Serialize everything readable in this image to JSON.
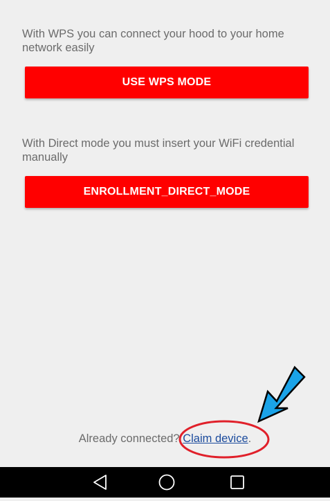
{
  "enrollment": {
    "wps_description": "With WPS you can connect your hood to your home network easily",
    "wps_button_label": "USE WPS MODE",
    "direct_description": "With Direct mode you must insert your WiFi credential manually",
    "direct_button_label": "ENROLLMENT_DIRECT_MODE"
  },
  "footer": {
    "already_connected_text": "Already connected?",
    "claim_link_label": "Claim device",
    "period": "."
  },
  "annotation": {
    "arrow_color": "#1aa3e8",
    "circle_color": "#e0202a"
  },
  "navigation_bar": {
    "items": [
      "back-icon",
      "home-icon",
      "recents-icon"
    ]
  },
  "colors": {
    "button_red": "#ff0000",
    "background": "#efefef",
    "link_blue": "#1a4a9c",
    "nav_black": "#000000"
  }
}
